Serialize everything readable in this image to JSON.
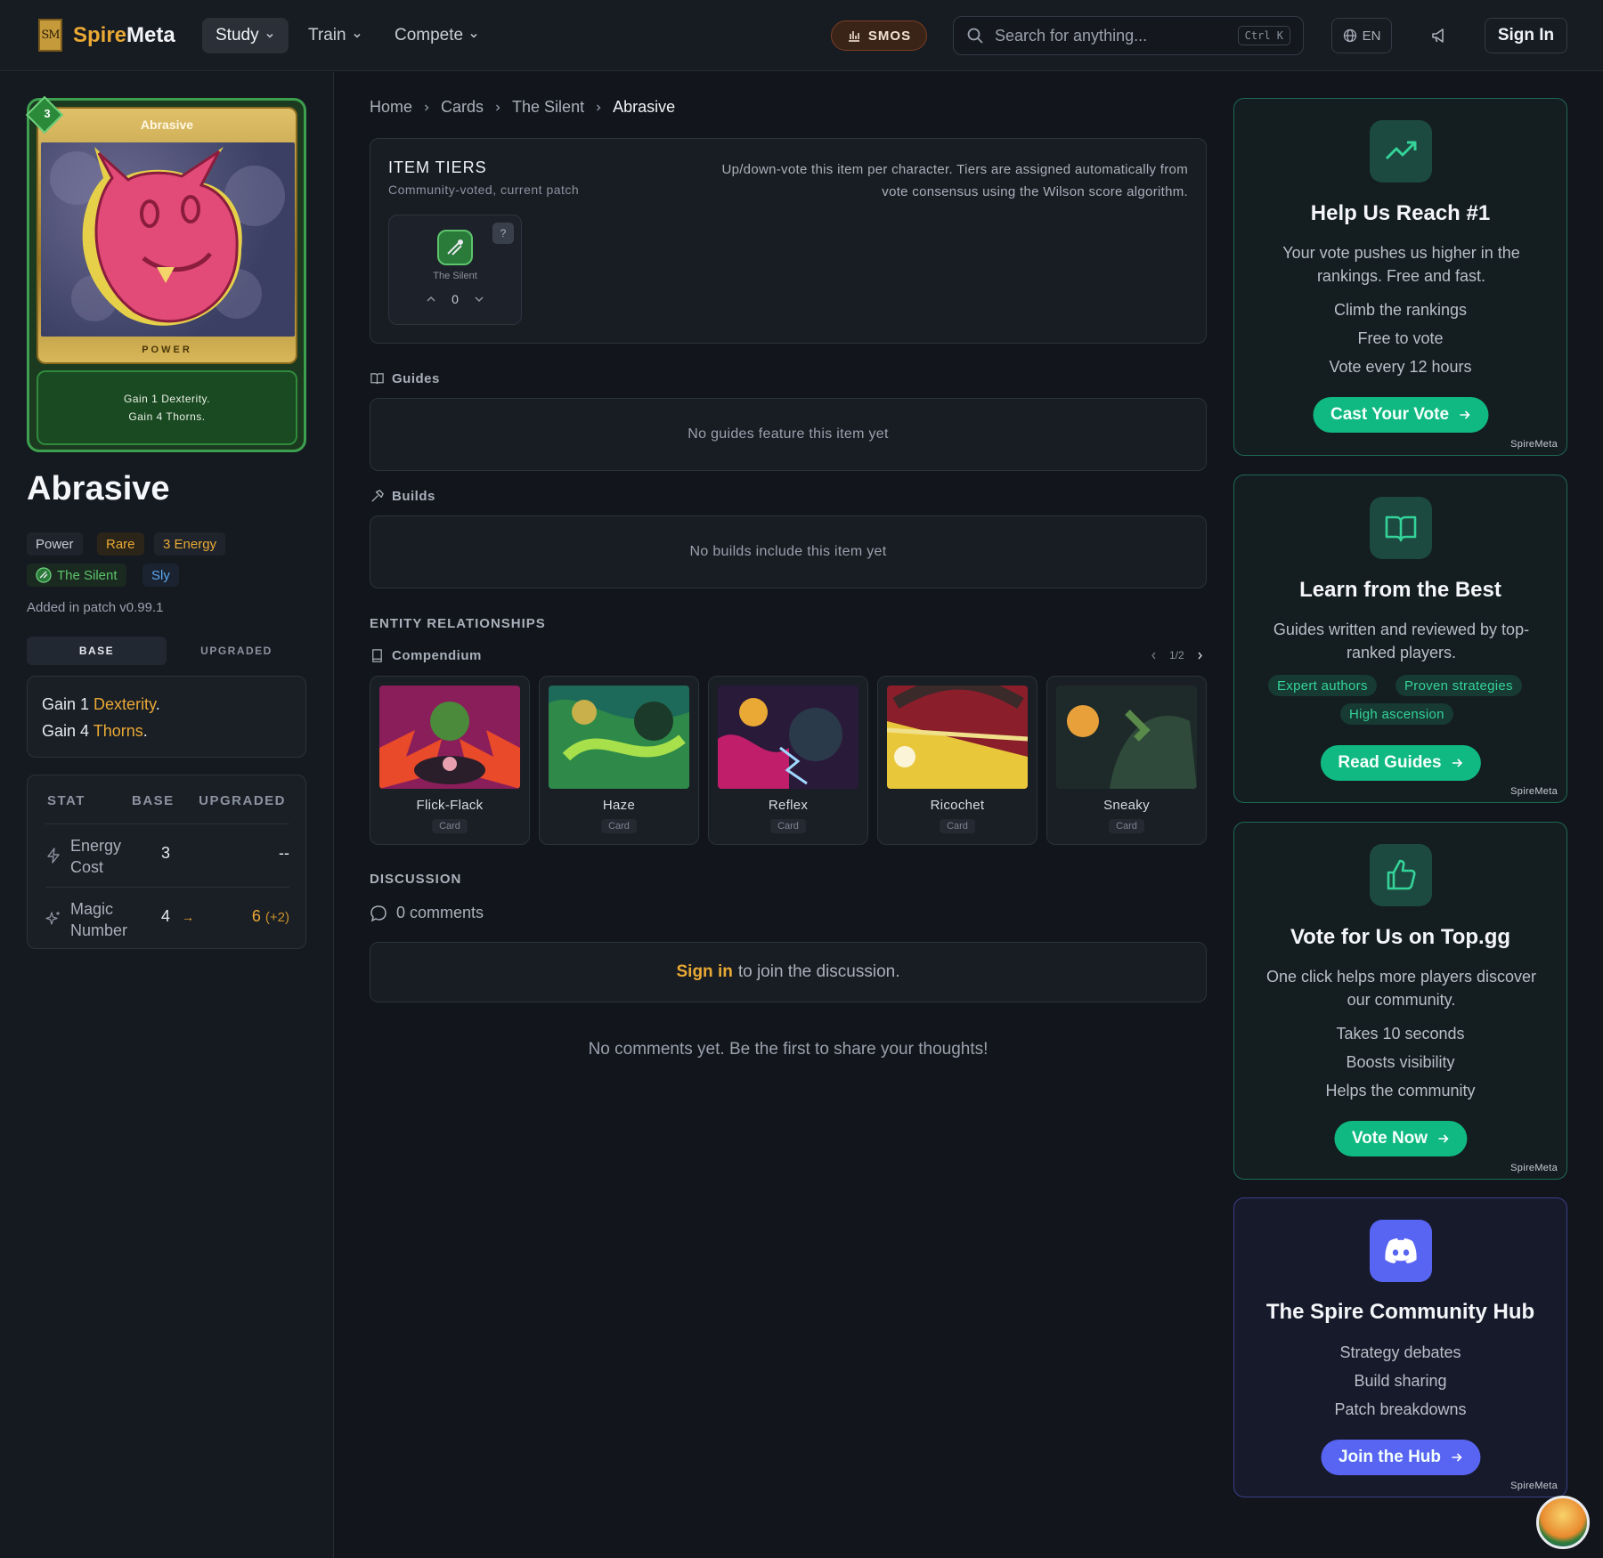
{
  "brand": {
    "logo": "SM",
    "name_a": "Spire",
    "name_b": "Meta"
  },
  "nav": [
    {
      "label": "Study",
      "active": true
    },
    {
      "label": "Train",
      "active": false
    },
    {
      "label": "Compete",
      "active": false
    }
  ],
  "smos_label": "SMOS",
  "search": {
    "placeholder": "Search for anything...",
    "shortcut": "Ctrl K"
  },
  "lang": "EN",
  "signin_label": "Sign In",
  "card": {
    "title": "Abrasive",
    "cost": "3",
    "type_label": "POWER",
    "desc_lines": [
      "Gain 1 Dexterity.",
      "Gain 4 Thorns."
    ]
  },
  "item_name": "Abrasive",
  "tags": {
    "type": "Power",
    "rarity": "Rare",
    "energy": "3 Energy",
    "character": "The Silent",
    "keyword": "Sly"
  },
  "patch_text": "Added in patch v0.99.1",
  "toggle": {
    "base": "BASE",
    "upgraded": "UPGRADED"
  },
  "description": {
    "l1_pre": "Gain 1 ",
    "l1_kw": "Dexterity",
    "l1_post": ".",
    "l2_pre": "Gain 4 ",
    "l2_kw": "Thorns",
    "l2_post": "."
  },
  "stats": {
    "headers": [
      "STAT",
      "BASE",
      "UPGRADED"
    ],
    "rows": [
      {
        "name": "Energy Cost",
        "base": "3",
        "upgraded": "--",
        "delta": ""
      },
      {
        "name": "Magic Number",
        "base": "4",
        "arrow": "→",
        "upgraded": "6",
        "delta": "(+2)"
      }
    ]
  },
  "breadcrumbs": [
    "Home",
    "Cards",
    "The Silent",
    "Abrasive"
  ],
  "tiers": {
    "title": "ITEM TIERS",
    "subtitle": "Community-voted, current patch",
    "info_l1": "Up/down-vote this item per character. Tiers are assigned automatically from",
    "info_l2": "vote consensus using the Wilson score algorithm.",
    "character": "The Silent",
    "help": "?",
    "votes": "0"
  },
  "guides": {
    "label": "Guides",
    "empty": "No guides feature this item yet"
  },
  "builds": {
    "label": "Builds",
    "empty": "No builds include this item yet"
  },
  "relationships": {
    "title": "ENTITY RELATIONSHIPS",
    "compendium": "Compendium",
    "page": "1/2",
    "cards": [
      {
        "name": "Flick-Flack",
        "type": "Card"
      },
      {
        "name": "Haze",
        "type": "Card"
      },
      {
        "name": "Reflex",
        "type": "Card"
      },
      {
        "name": "Ricochet",
        "type": "Card"
      },
      {
        "name": "Sneaky",
        "type": "Card"
      }
    ]
  },
  "discussion": {
    "title": "DISCUSSION",
    "count": "0 comments",
    "signin_link": "Sign in",
    "signin_rest": "to join the discussion.",
    "empty": "No comments yet. Be the first to share your thoughts!"
  },
  "promos": [
    {
      "icon": "trending-up-icon",
      "title": "Help Us Reach #1",
      "desc": "Your vote pushes us higher in the rankings. Free and fast.",
      "lines": [
        "Climb the rankings",
        "Free to vote",
        "Vote every 12 hours"
      ],
      "button": "Cast Your Vote",
      "footer": "SpireMeta"
    },
    {
      "icon": "book-open-icon",
      "title": "Learn from the Best",
      "desc": "Guides written and reviewed by top-ranked players.",
      "chips": [
        "Expert authors",
        "Proven strategies",
        "High ascension"
      ],
      "button": "Read Guides",
      "footer": "SpireMeta"
    },
    {
      "icon": "thumbs-up-icon",
      "title": "Vote for Us on Top.gg",
      "desc": "One click helps more players discover our community.",
      "lines": [
        "Takes 10 seconds",
        "Boosts visibility",
        "Helps the community"
      ],
      "button": "Vote Now",
      "footer": "SpireMeta"
    },
    {
      "icon": "discord-icon",
      "title": "The Spire Community Hub",
      "lines": [
        "Strategy debates",
        "Build sharing",
        "Patch breakdowns"
      ],
      "button": "Join the Hub",
      "footer": "SpireMeta"
    }
  ],
  "colors": {
    "accent_gold": "#e9a934",
    "accent_green": "#10b981",
    "discord": "#5865f2",
    "background": "#12151b"
  }
}
